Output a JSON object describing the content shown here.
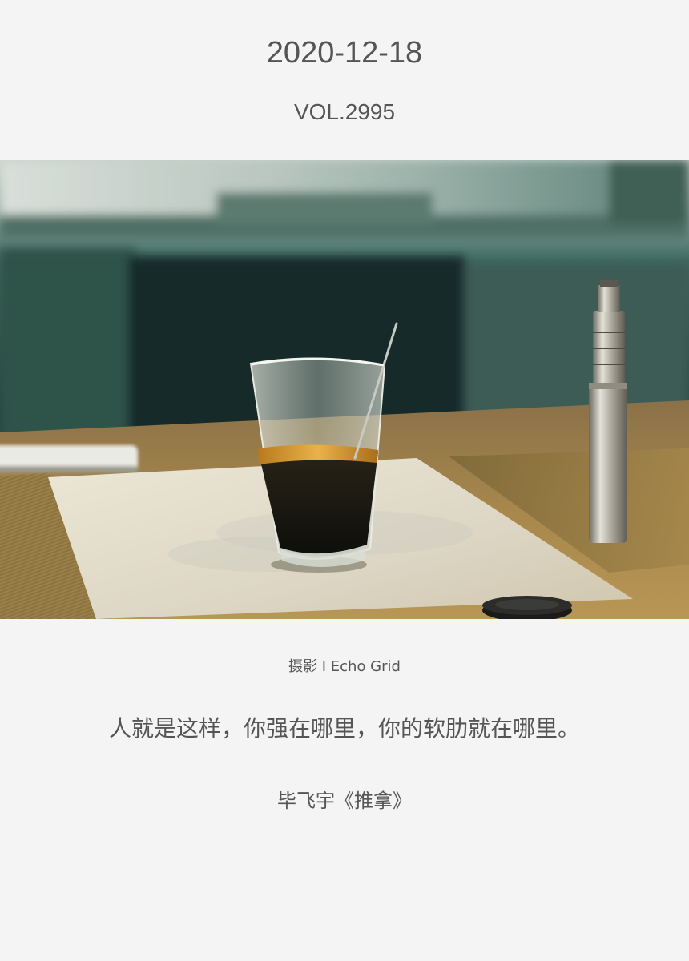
{
  "header": {
    "date": "2020-12-18",
    "volume": "VOL.2995"
  },
  "photo": {
    "subject": "glass-of-coffee-on-table",
    "palette": {
      "wall": "#24524c",
      "table": "#a8864a",
      "paper": "#e6dfcf",
      "coffee": "#1a1a14",
      "crema": "#d49a2a"
    }
  },
  "caption": {
    "credit": "摄影 I Echo Grid",
    "quote": "人就是这样，你强在哪里，你的软肋就在哪里。",
    "author": "毕飞宇《推拿》"
  }
}
